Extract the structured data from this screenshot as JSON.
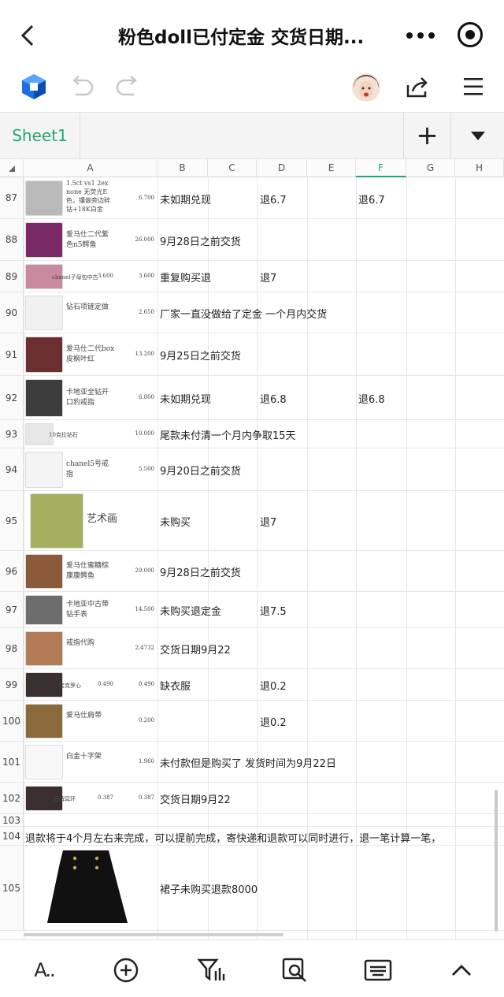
{
  "header": {
    "title": "粉色doll已付定金 交货日期...",
    "back_glyph": "‹"
  },
  "toolbar": {
    "icons": [
      "app-logo-icon",
      "undo-icon",
      "redo-icon",
      "avatar",
      "share-icon",
      "menu-icon"
    ]
  },
  "sheetbar": {
    "tab_label": "Sheet1",
    "add_glyph": "+"
  },
  "columns": [
    "A",
    "B",
    "C",
    "D",
    "E",
    "F",
    "G",
    "H"
  ],
  "rows": [
    {
      "num": "87",
      "desc": "1.5ct vs1 2ex none 无荧光E色，镶嵌旁边碎钻+18K白金",
      "price": "6.700",
      "b": "未如期兑现",
      "d": "退6.7",
      "f": "退6.7"
    },
    {
      "num": "88",
      "desc": "爱马仕二代紫色n5鳄鱼",
      "price": "26.000",
      "b": "9月28日之前交货",
      "d": "",
      "f": ""
    },
    {
      "num": "89",
      "desc": "chanel子母包中古",
      "price": "3.600",
      "price2": "3.600",
      "b": "重复购买退",
      "d": "退7",
      "f": ""
    },
    {
      "num": "90",
      "desc": "钻石项链定做",
      "price": "2.650",
      "b": "厂家一直没做给了定金 一个月内交货",
      "d": "",
      "f": ""
    },
    {
      "num": "91",
      "desc": "爱马仕二代box皮枫叶红",
      "price": "13.200",
      "b": "9月25日之前交货",
      "d": "",
      "f": ""
    },
    {
      "num": "92",
      "desc": "卡地亚全钻开口豹戒指",
      "price": "6.800",
      "b": "未如期兑现",
      "d": "退6.8",
      "f": "退6.8"
    },
    {
      "num": "93",
      "desc": "10克拉钻石",
      "price": "10.000",
      "b": "尾款未付清一个月内争取15天",
      "d": "",
      "f": ""
    },
    {
      "num": "94",
      "desc": "chanel5号戒指",
      "price": "5.500",
      "b": "9月20日之前交货",
      "d": "",
      "f": ""
    },
    {
      "num": "95",
      "desc": "艺术画",
      "price": "",
      "b": "未购买",
      "d": "退7",
      "f": ""
    },
    {
      "num": "96",
      "desc": "爱马仕蜜糖棕康康鳄鱼",
      "price": "29.000",
      "b": "9月28日之前交货",
      "d": "",
      "f": ""
    },
    {
      "num": "97",
      "desc": "卡地亚中古带钻手表",
      "price": "14.500",
      "b": "未购买退定金",
      "d": "退7.5",
      "f": ""
    },
    {
      "num": "98",
      "desc": "戒指代购",
      "price": "2.4732",
      "b": "交货日期9月22",
      "d": "",
      "f": ""
    },
    {
      "num": "99",
      "desc": "一套克罗心",
      "price": "0.490",
      "price2": "0.490",
      "b": "缺衣服",
      "d": "退0.2",
      "f": ""
    },
    {
      "num": "100",
      "desc": "爱马仕肩带",
      "price": "0.200",
      "b": "",
      "d": "退0.2",
      "f": ""
    },
    {
      "num": "101",
      "desc": "白金十字架",
      "price": "1.960",
      "b": "未付款但是购买了 发货时间为9月22日",
      "d": "",
      "f": ""
    },
    {
      "num": "102",
      "desc": "品牌耳环",
      "price": "0.387",
      "price2": "0.387",
      "b": "交货日期9月22",
      "d": "",
      "f": ""
    },
    {
      "num": "103",
      "desc": "",
      "price": "",
      "b": "",
      "d": "",
      "f": ""
    },
    {
      "num": "104",
      "note": "退款将于4个月左右来完成，可以提前完成，寄快递和退款可以同时进行，退一笔计算一笔，"
    },
    {
      "num": "105",
      "desc": "",
      "price": "",
      "b": "裙子未购买退款8000",
      "d": "",
      "f": ""
    }
  ],
  "bottom_toolbar": {
    "icons": [
      "text-format-icon",
      "insert-icon",
      "filter-icon",
      "search-icon",
      "keyboard-icon",
      "collapse-icon"
    ],
    "format_label": "A.."
  },
  "colors": {
    "accent": "#20a86c",
    "text": "#222222",
    "grid": "#e6e6e6"
  }
}
